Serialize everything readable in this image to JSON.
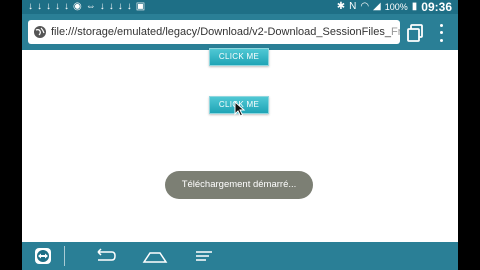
{
  "statusbar": {
    "icons_left": [
      "download-icon",
      "download-icon",
      "download-icon",
      "download-icon",
      "download-icon",
      "eye-icon",
      "teamviewer-icon",
      "download-icon",
      "download-icon",
      "download-icon",
      "download-icon",
      "notification-icon"
    ],
    "battery": "100%",
    "time": "09:36"
  },
  "browser": {
    "url_main": "file:///storage/emulated/legacy/Download/v2-Download_SessionFiles_",
    "url_faded": "Fro"
  },
  "page": {
    "button1_label": "CLICK ME",
    "button2_label": "CLICK ME",
    "toast_text": "Téléchargement démarré..."
  },
  "colors": {
    "bar": "#2a7f96",
    "button": "#1fa4b6",
    "toast": "#7c7f74"
  }
}
